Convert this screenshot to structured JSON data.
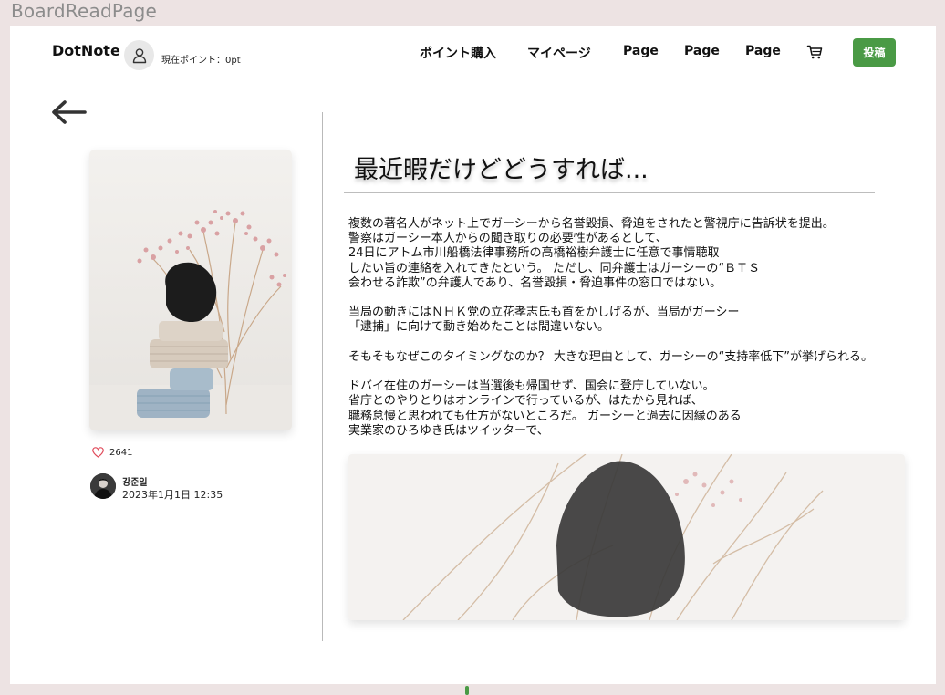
{
  "frame": {
    "label": "BoardReadPage"
  },
  "header": {
    "logo": "DotNote",
    "points_label": "現在ポイント：0pt",
    "nav": [
      "ポイント購入",
      "マイページ",
      "Page",
      "Page",
      "Page"
    ],
    "post_button": "投稿",
    "accent_color": "#4a9a45"
  },
  "post": {
    "likes": "2641",
    "author": {
      "name": "강준일",
      "date": "2023年1月1日 12:35"
    },
    "title": "最近暇だけどどうすれば...",
    "paragraphs": [
      [
        "複数の著名人がネット上でガーシーから名誉毀損、脅迫をされたと警視庁に告訴状を提出。",
        "警察はガーシー本人からの聞き取りの必要性があるとして、",
        "24日にアトム市川船橋法律事務所の高橋裕樹弁護士に任意で事情聴取",
        "したい旨の連絡を入れてきたという。 ただし、同弁護士はガーシーの“ＢＴＳ",
        "会わせる詐欺”の弁護人であり、名誉毀損・脅迫事件の窓口ではない。"
      ],
      [
        "当局の動きにはＮＨＫ党の立花孝志氏も首をかしげるが、当局がガーシー",
        "「逮捕」に向けて動き始めたことは間違いない。"
      ],
      [
        "そもそもなぜこのタイミングなのか？ 大きな理由として、ガーシーの“支持率低下”が挙げられる。"
      ],
      [
        "ドバイ在住のガーシーは当選後も帰国せず、国会に登庁していない。",
        "省庁とのやりとりはオンラインで行っているが、はたから見れば、",
        "職務怠慢と思われても仕方がないところだ。 ガーシーと過去に因縁のある",
        "実業家のひろゆき氏はツイッターで、"
      ]
    ]
  }
}
